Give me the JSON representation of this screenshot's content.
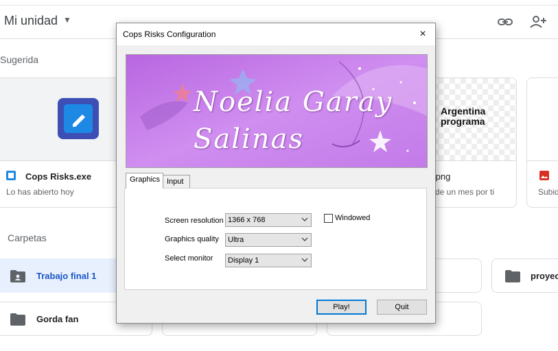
{
  "drive": {
    "title": "Mi unidad",
    "sections": {
      "suggested": "Sugerida",
      "folders": "Carpetas"
    },
    "cards": [
      {
        "name": "Cops Risks.exe",
        "subtitle": "Lo has abierto hoy"
      },
      {
        "name": ".png",
        "subtitle": "de un mes por ti",
        "thumb_text_1": "Argentina",
        "thumb_text_2": "programa"
      },
      {
        "name": "",
        "subtitle": "Subid"
      }
    ],
    "folders": [
      {
        "label": "Trabajo final 1"
      },
      {
        "label": "Gorda fan"
      },
      {
        "label": "proyect"
      }
    ]
  },
  "dialog": {
    "title": "Cops Risks Configuration",
    "close_icon": "×",
    "banner": {
      "line1": "Noelia Garay",
      "line2": "Salinas"
    },
    "tabs": [
      "Graphics",
      "Input"
    ],
    "fields": {
      "resolution": {
        "label": "Screen resolution",
        "value": "1366 x 768"
      },
      "quality": {
        "label": "Graphics quality",
        "value": "Ultra"
      },
      "monitor": {
        "label": "Select monitor",
        "value": "Display 1"
      }
    },
    "windowed_label": "Windowed",
    "buttons": {
      "play": "Play!",
      "quit": "Quit"
    }
  },
  "colors": {
    "accent": "#0078d7",
    "selected_folder_bg": "#e8f0fe",
    "banner_purple": "#c070e0"
  }
}
